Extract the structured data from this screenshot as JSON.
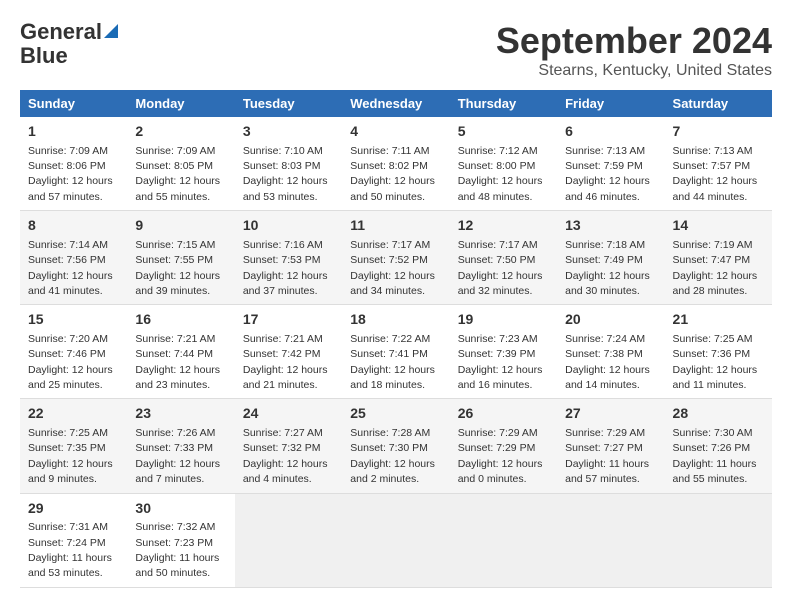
{
  "header": {
    "logo_line1": "General",
    "logo_line2": "Blue",
    "month": "September 2024",
    "location": "Stearns, Kentucky, United States"
  },
  "weekdays": [
    "Sunday",
    "Monday",
    "Tuesday",
    "Wednesday",
    "Thursday",
    "Friday",
    "Saturday"
  ],
  "weeks": [
    [
      {
        "day": "1",
        "info": "Sunrise: 7:09 AM\nSunset: 8:06 PM\nDaylight: 12 hours\nand 57 minutes."
      },
      {
        "day": "2",
        "info": "Sunrise: 7:09 AM\nSunset: 8:05 PM\nDaylight: 12 hours\nand 55 minutes."
      },
      {
        "day": "3",
        "info": "Sunrise: 7:10 AM\nSunset: 8:03 PM\nDaylight: 12 hours\nand 53 minutes."
      },
      {
        "day": "4",
        "info": "Sunrise: 7:11 AM\nSunset: 8:02 PM\nDaylight: 12 hours\nand 50 minutes."
      },
      {
        "day": "5",
        "info": "Sunrise: 7:12 AM\nSunset: 8:00 PM\nDaylight: 12 hours\nand 48 minutes."
      },
      {
        "day": "6",
        "info": "Sunrise: 7:13 AM\nSunset: 7:59 PM\nDaylight: 12 hours\nand 46 minutes."
      },
      {
        "day": "7",
        "info": "Sunrise: 7:13 AM\nSunset: 7:57 PM\nDaylight: 12 hours\nand 44 minutes."
      }
    ],
    [
      {
        "day": "8",
        "info": "Sunrise: 7:14 AM\nSunset: 7:56 PM\nDaylight: 12 hours\nand 41 minutes."
      },
      {
        "day": "9",
        "info": "Sunrise: 7:15 AM\nSunset: 7:55 PM\nDaylight: 12 hours\nand 39 minutes."
      },
      {
        "day": "10",
        "info": "Sunrise: 7:16 AM\nSunset: 7:53 PM\nDaylight: 12 hours\nand 37 minutes."
      },
      {
        "day": "11",
        "info": "Sunrise: 7:17 AM\nSunset: 7:52 PM\nDaylight: 12 hours\nand 34 minutes."
      },
      {
        "day": "12",
        "info": "Sunrise: 7:17 AM\nSunset: 7:50 PM\nDaylight: 12 hours\nand 32 minutes."
      },
      {
        "day": "13",
        "info": "Sunrise: 7:18 AM\nSunset: 7:49 PM\nDaylight: 12 hours\nand 30 minutes."
      },
      {
        "day": "14",
        "info": "Sunrise: 7:19 AM\nSunset: 7:47 PM\nDaylight: 12 hours\nand 28 minutes."
      }
    ],
    [
      {
        "day": "15",
        "info": "Sunrise: 7:20 AM\nSunset: 7:46 PM\nDaylight: 12 hours\nand 25 minutes."
      },
      {
        "day": "16",
        "info": "Sunrise: 7:21 AM\nSunset: 7:44 PM\nDaylight: 12 hours\nand 23 minutes."
      },
      {
        "day": "17",
        "info": "Sunrise: 7:21 AM\nSunset: 7:42 PM\nDaylight: 12 hours\nand 21 minutes."
      },
      {
        "day": "18",
        "info": "Sunrise: 7:22 AM\nSunset: 7:41 PM\nDaylight: 12 hours\nand 18 minutes."
      },
      {
        "day": "19",
        "info": "Sunrise: 7:23 AM\nSunset: 7:39 PM\nDaylight: 12 hours\nand 16 minutes."
      },
      {
        "day": "20",
        "info": "Sunrise: 7:24 AM\nSunset: 7:38 PM\nDaylight: 12 hours\nand 14 minutes."
      },
      {
        "day": "21",
        "info": "Sunrise: 7:25 AM\nSunset: 7:36 PM\nDaylight: 12 hours\nand 11 minutes."
      }
    ],
    [
      {
        "day": "22",
        "info": "Sunrise: 7:25 AM\nSunset: 7:35 PM\nDaylight: 12 hours\nand 9 minutes."
      },
      {
        "day": "23",
        "info": "Sunrise: 7:26 AM\nSunset: 7:33 PM\nDaylight: 12 hours\nand 7 minutes."
      },
      {
        "day": "24",
        "info": "Sunrise: 7:27 AM\nSunset: 7:32 PM\nDaylight: 12 hours\nand 4 minutes."
      },
      {
        "day": "25",
        "info": "Sunrise: 7:28 AM\nSunset: 7:30 PM\nDaylight: 12 hours\nand 2 minutes."
      },
      {
        "day": "26",
        "info": "Sunrise: 7:29 AM\nSunset: 7:29 PM\nDaylight: 12 hours\nand 0 minutes."
      },
      {
        "day": "27",
        "info": "Sunrise: 7:29 AM\nSunset: 7:27 PM\nDaylight: 11 hours\nand 57 minutes."
      },
      {
        "day": "28",
        "info": "Sunrise: 7:30 AM\nSunset: 7:26 PM\nDaylight: 11 hours\nand 55 minutes."
      }
    ],
    [
      {
        "day": "29",
        "info": "Sunrise: 7:31 AM\nSunset: 7:24 PM\nDaylight: 11 hours\nand 53 minutes."
      },
      {
        "day": "30",
        "info": "Sunrise: 7:32 AM\nSunset: 7:23 PM\nDaylight: 11 hours\nand 50 minutes."
      },
      {
        "day": "",
        "info": ""
      },
      {
        "day": "",
        "info": ""
      },
      {
        "day": "",
        "info": ""
      },
      {
        "day": "",
        "info": ""
      },
      {
        "day": "",
        "info": ""
      }
    ]
  ]
}
